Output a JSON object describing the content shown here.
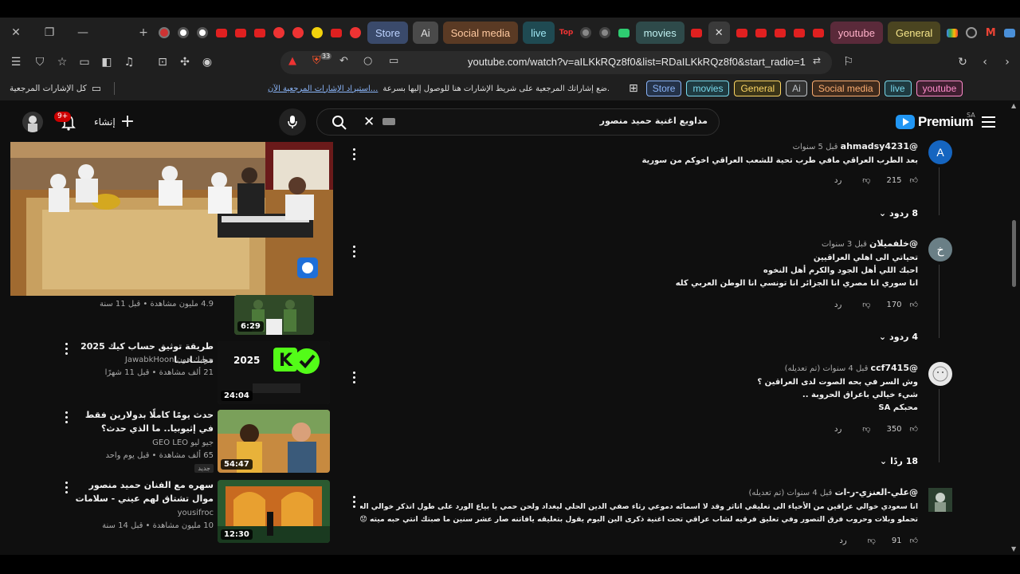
{
  "browser": {
    "url": "youtube.com/watch?v=aILKkRQz8f0&list=RDaILKkRQz8f0&start_radio=1",
    "shield_count": "33",
    "tab_groups": [
      {
        "label": "Store",
        "bg": "#3a4a6b",
        "fg": "#bcd2ff"
      },
      {
        "label": "Ai",
        "bg": "#4a4a4a",
        "fg": "#e0e0e0"
      },
      {
        "label": "Social media",
        "bg": "#5a3a24",
        "fg": "#ffc9a0"
      },
      {
        "label": "live",
        "bg": "#1f4a52",
        "fg": "#9fe6f2"
      },
      {
        "label": "movies",
        "bg": "#2e4a4a",
        "fg": "#bff0f0"
      },
      {
        "label": "youtube",
        "bg": "#5a2a3a",
        "fg": "#ffb0c8"
      },
      {
        "label": "General",
        "bg": "#4a4420",
        "fg": "#f5e58a"
      }
    ],
    "bookmarks": {
      "all_bookmarks": "كل الإشارات المرجعية",
      "import_link": "استيراد الإشارات المرجعية الآن...",
      "hint": "ضع إشاراتك المرجعية على شريط الإشارات هنا للوصول إليها بسرعة.",
      "chips": [
        {
          "label": "Store",
          "color": "#8ab4f8"
        },
        {
          "label": "movies",
          "color": "#78d9ec"
        },
        {
          "label": "General",
          "color": "#fdd663"
        },
        {
          "label": "Ai",
          "color": "#bdc1c6"
        },
        {
          "label": "Social media",
          "color": "#fcad70"
        },
        {
          "label": "live",
          "color": "#78d9ec"
        },
        {
          "label": "youtube",
          "color": "#ff8bcb"
        }
      ]
    }
  },
  "masthead": {
    "logo_text": "Premium",
    "country": "SA",
    "search_query": "مداويع اغنية حميد منصور",
    "create_label": "إنشاء",
    "notif_badge": "9+"
  },
  "related": [
    {
      "title": "",
      "channel": "",
      "meta": "4.9 مليون مشاهدة • قبل 11 سنة",
      "duration": "6:29",
      "thumb": "thumb-soldiers"
    },
    {
      "title": "طريقة توثيق حساب كيك 2025 مجـــانـــا",
      "channel": "جوابك هون JawabkHoon",
      "meta": "21 ألف مشاهدة • قبل 11 شهرًا",
      "duration": "24:04",
      "thumb": "thumb-kick"
    },
    {
      "title": "حدث يومًا كاملًا بدولارين فقط في إثيوبيا.. ما الذي حدث؟",
      "channel": "جيو ليو GEO LEO",
      "meta": "65 ألف مشاهدة • قبل يوم واحد",
      "duration": "54:47",
      "thumb": "thumb-ethiopia",
      "badge": "جديد"
    },
    {
      "title": "سهره مع الفنان حميد منصور موال تشتاق لهم عيني - سلامات",
      "channel": "yousifroc",
      "meta": "10 مليون مشاهدة • قبل 14 سنة",
      "duration": "12:30",
      "thumb": "thumb-concert"
    }
  ],
  "comments": [
    {
      "author": "@ahmadsy4231",
      "time": "قبل 5 سنوات",
      "avatar_letter": "A",
      "avatar_color": "#1565c0",
      "lines": [
        "بعد الطرب العراقي مافي طرب تحية للشعب العراقي اخوكم من سورية"
      ],
      "likes": "215",
      "reply_label": "رد",
      "replies": "8 ردود"
    },
    {
      "author": "@خلفميلان",
      "time": "قبل 3 سنوات",
      "avatar_letter": "خ",
      "avatar_color": "#6a7f86",
      "lines": [
        "تحياتي الى اهلي العراقيين",
        "احبك اللي أهل الجود والكرم أهل النخوه",
        "انا سوري انا مصري انا الجزائر انا تونسي انا الوطن العربي كله"
      ],
      "likes": "170",
      "reply_label": "رد",
      "replies": "4 ردود"
    },
    {
      "author": "@ccf7415",
      "time": "قبل 4 سنوات (تم تعديله)",
      "avatar_letter": "",
      "avatar_color": "#e8e8e8",
      "lines": [
        "وش السر في بحه الصوت لدى العراقين ؟",
        "شيء خيالي باعراق الحروبة ..",
        "محبكم SA"
      ],
      "likes": "350",
      "reply_label": "رد",
      "replies": "18 ردًا"
    },
    {
      "author": "@علي-العنزي-ر-ات",
      "time": "قبل 4 سنوات (تم تعديله)",
      "avatar_letter": "",
      "avatar_color": "#3a5a3a",
      "lines": [
        "انا سعودي خوالي عراقين من الأحياء الى تعليقي اتاثر وقد لا اسمائه دموعي رثاء صفي الدين الحلي ليغداد ولحن حمي يا بياع الورد على طول اتذكر خوالي العراقين  والدمع راسا سال",
        "تحملو وبلات وحروب فرق التصور وفي تعليق فرقيه لشاب عراقي تحت اغنية ذكرى الين اليوم يقول بتعليقه يافاتنه صار عشر سنين ما صبتك انتي حبه ميته 😟"
      ],
      "likes": "91",
      "reply_label": "رد",
      "replies": ""
    }
  ]
}
